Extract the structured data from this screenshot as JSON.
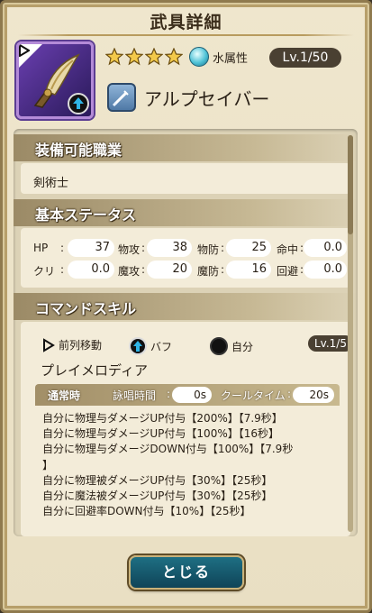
{
  "dialog": {
    "title": "武具詳細",
    "close_label": "とじる"
  },
  "weapon": {
    "rarity_stars": 4,
    "element_label": "水属性",
    "level": "Lv.1/50",
    "name": "アルプセイバー",
    "icon": "curved-blade-icon",
    "type_icon": "sword-type-icon"
  },
  "equip_jobs": {
    "heading": "装備可能職業",
    "value": "剣術士"
  },
  "base_stats": {
    "heading": "基本ステータス",
    "rows": [
      [
        {
          "label": "HP",
          "value": "37"
        },
        {
          "label": "物攻",
          "value": "38"
        },
        {
          "label": "物防",
          "value": "25"
        },
        {
          "label": "命中",
          "value": "0.0"
        }
      ],
      [
        {
          "label": "クリ",
          "value": "0.0"
        },
        {
          "label": "魔攻",
          "value": "20"
        },
        {
          "label": "魔防",
          "value": "16"
        },
        {
          "label": "回避",
          "value": "0.0"
        }
      ]
    ]
  },
  "command_skill": {
    "heading": "コマンドスキル",
    "legend": {
      "position": "前列移動",
      "buff": "バフ",
      "target": "自分"
    },
    "level": "Lv.1/5",
    "name": "プレイメロディア",
    "timing": {
      "mode": "通常時",
      "cast_label": "詠唱時間",
      "cast_value": "0s",
      "cooldown_label": "クールタイム",
      "cooldown_value": "20s"
    },
    "effects": [
      "自分に物理与ダメージUP付与【200%】【7.9秒】",
      "自分に物理与ダメージUP付与【100%】【16秒】",
      "自分に物理与ダメージDOWN付与【100%】【7.9秒",
      "】",
      "自分に物理被ダメージUP付与【30%】【25秒】",
      "自分に魔法被ダメージUP付与【30%】【25秒】",
      "自分に回避率DOWN付与【10%】【25秒】"
    ]
  },
  "colors": {
    "frame": "#8f7a4e",
    "panel": "#dcd2b6",
    "pill_dark": "#4a4032",
    "button_teal": "#1e6f83"
  }
}
